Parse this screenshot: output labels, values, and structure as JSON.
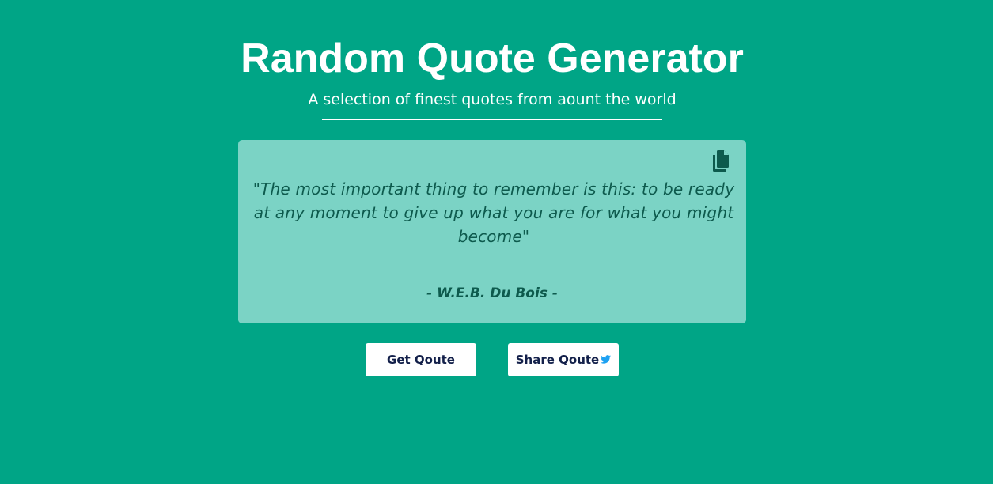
{
  "header": {
    "title": "Random Quote Generator",
    "subtitle": "A selection of finest quotes from aount the world"
  },
  "quote_card": {
    "copy_icon": "copy-icon",
    "text": "\"The most important thing to remember is this: to be ready at any moment to give up what you are for what you might become\"",
    "author": "- W.E.B. Du Bois -"
  },
  "actions": {
    "get_label": "Get Qoute",
    "share_label": "Share Qoute",
    "share_icon": "twitter-icon"
  },
  "colors": {
    "background": "#00a586",
    "card": "#7bd3c5",
    "quote_text": "#0d5a4d",
    "button_text": "#13204a",
    "twitter": "#1da1f2"
  }
}
